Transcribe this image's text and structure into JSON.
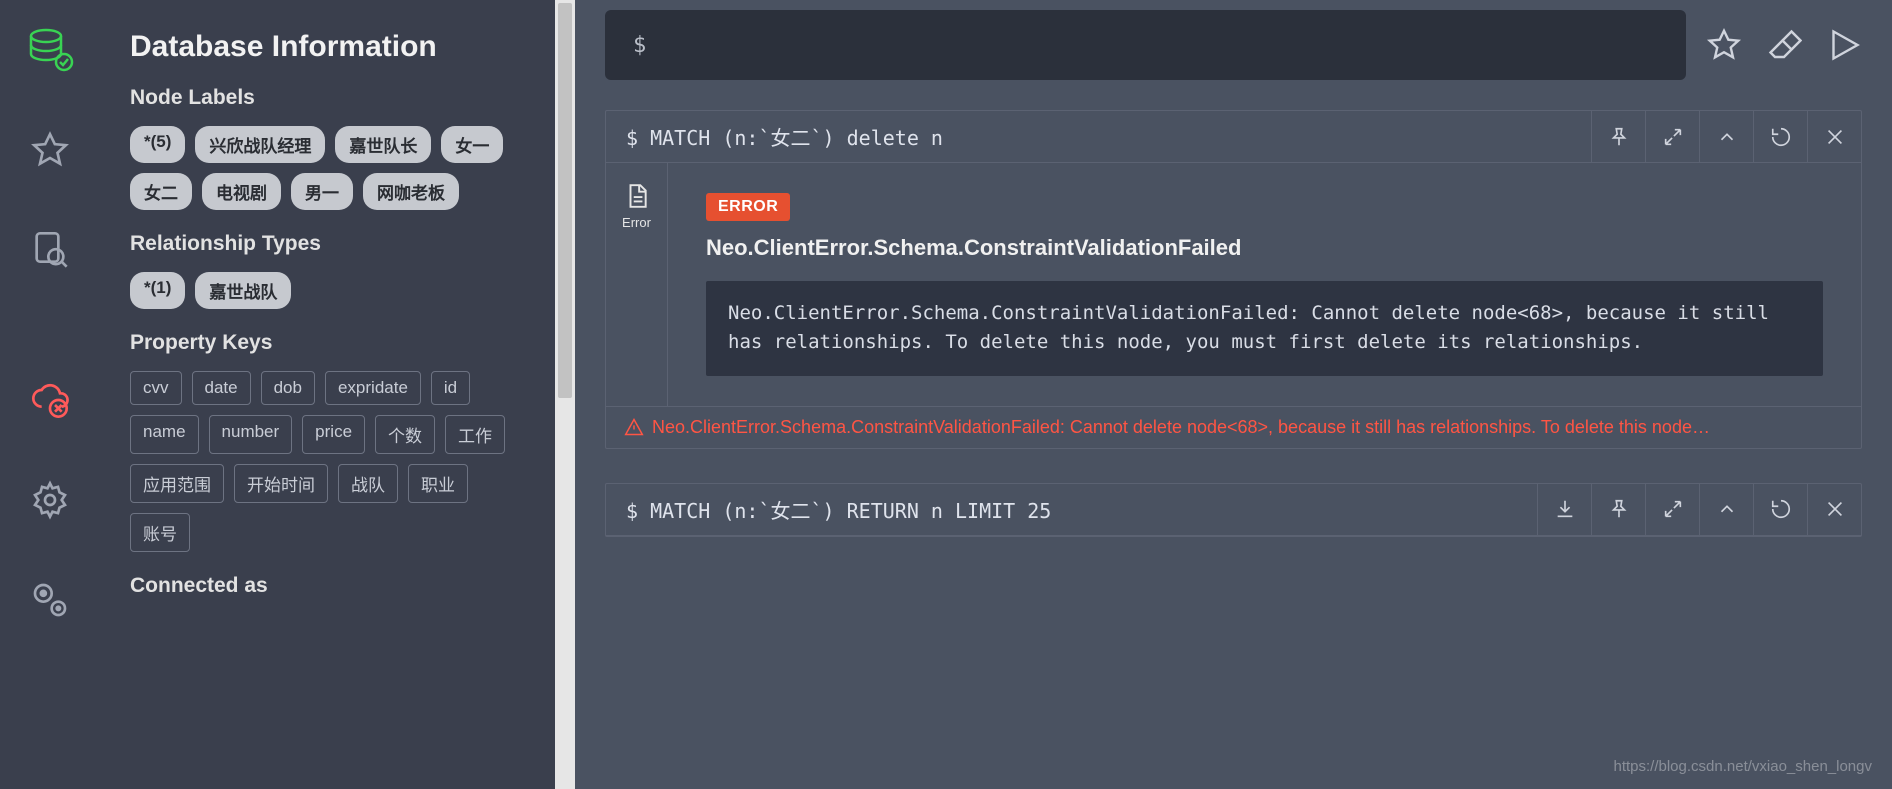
{
  "sidebar": {
    "title": "Database Information",
    "labels_heading": "Node Labels",
    "labels": [
      "*(5)",
      "兴欣战队经理",
      "嘉世队长",
      "女一",
      "女二",
      "电视剧",
      "男一",
      "网咖老板"
    ],
    "reltypes_heading": "Relationship Types",
    "reltypes": [
      "*(1)",
      "嘉世战队"
    ],
    "propkeys_heading": "Property Keys",
    "propkeys": [
      "cvv",
      "date",
      "dob",
      "expridate",
      "id",
      "name",
      "number",
      "price",
      "个数",
      "工作",
      "应用范围",
      "开始时间",
      "战队",
      "职业",
      "账号"
    ],
    "connected_heading": "Connected as"
  },
  "editor": {
    "prompt": "$"
  },
  "cards": {
    "error": {
      "cmd": "$ MATCH (n:`女二`) delete n",
      "side_label": "Error",
      "badge": "ERROR",
      "title": "Neo.ClientError.Schema.ConstraintValidationFailed",
      "message": "Neo.ClientError.Schema.ConstraintValidationFailed: Cannot delete node<68>, because it still has relationships. To delete this node, you must first delete its relationships.",
      "footer": "Neo.ClientError.Schema.ConstraintValidationFailed: Cannot delete node<68>, because it still has relationships. To delete this node…"
    },
    "result": {
      "cmd": "$ MATCH (n:`女二`) RETURN n LIMIT 25"
    }
  },
  "watermark": "https://blog.csdn.net/vxiao_shen_longv"
}
